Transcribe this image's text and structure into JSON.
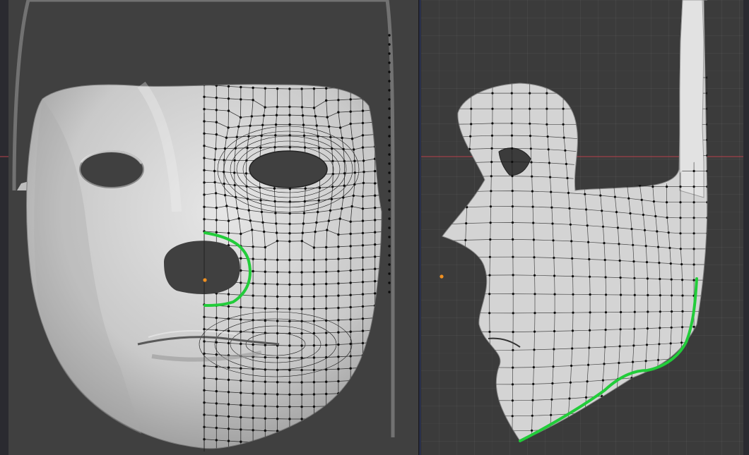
{
  "colors": {
    "viewport_bg": "#404040",
    "ortho_bg": "#3b3b3b",
    "mesh_surface": "#cfcfcf",
    "wire": "#1a1a1a",
    "vertex": "#0d0d0d",
    "guide_curve": "#22cc3a",
    "origin": "#f09020",
    "x_axis_line": "#b8424c",
    "splitter": "#3a4a7a"
  },
  "viewports": [
    {
      "name": "front-view",
      "icon": "mask-front-icon"
    },
    {
      "name": "side-view",
      "icon": "mask-side-icon"
    }
  ]
}
